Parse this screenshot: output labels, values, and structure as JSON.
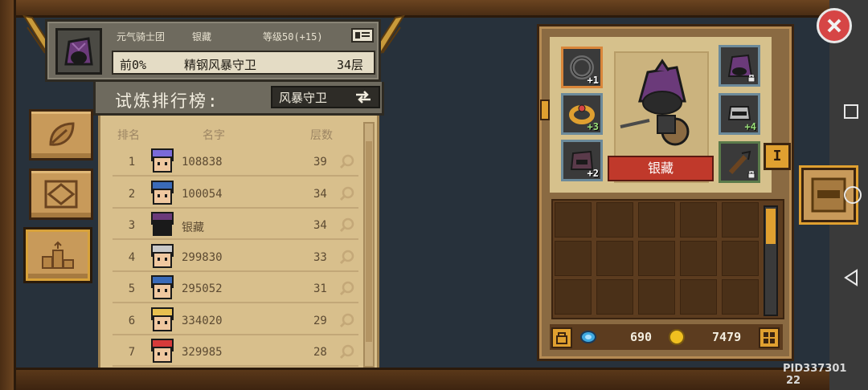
{
  "profile": {
    "guild": "元气骑士团",
    "player_name": "银藏",
    "level": "等级50(+15)",
    "rank_percent": "前0%",
    "boss_title": "精钢风暴守卫",
    "floor": "34层"
  },
  "leaderboard": {
    "title": "试炼排行榜:",
    "boss_select": "风暴守卫",
    "headers": {
      "rank": "排名",
      "name": "名字",
      "floor": "层数"
    },
    "rows": [
      {
        "rank": "1",
        "name": "108838",
        "floor": "39",
        "avatar": "purple-hair"
      },
      {
        "rank": "2",
        "name": "100054",
        "floor": "34",
        "avatar": "cap-knight"
      },
      {
        "rank": "3",
        "name": "银藏",
        "floor": "34",
        "avatar": "purple-hood"
      },
      {
        "rank": "4",
        "name": "299830",
        "floor": "33",
        "avatar": "silver-helm"
      },
      {
        "rank": "5",
        "name": "295052",
        "floor": "31",
        "avatar": "cap-knight"
      },
      {
        "rank": "6",
        "name": "334020",
        "floor": "29",
        "avatar": "blonde-hat"
      },
      {
        "rank": "7",
        "name": "329985",
        "floor": "28",
        "avatar": "red-hair"
      }
    ]
  },
  "equipment": {
    "character_name": "银藏",
    "tier": "I",
    "slots_left": [
      {
        "icon": "ring-dark-icon",
        "plus": "+1"
      },
      {
        "icon": "ring-gold-icon",
        "plus": "+3"
      },
      {
        "icon": "helmet-purple-icon",
        "plus": "+2"
      }
    ],
    "slots_right": [
      {
        "icon": "hood-purple-icon",
        "locked": true
      },
      {
        "icon": "helmet-silver-icon",
        "plus": "+4"
      },
      {
        "icon": "weapon-staff-icon",
        "locked": true
      }
    ]
  },
  "currency": {
    "gems": "690",
    "coins": "7479"
  },
  "footer": {
    "pid": "PID337301",
    "page": "22"
  },
  "colors": {
    "accent": "#e0a030",
    "ribbon": "#c0392b",
    "panel": "#d8bf8c",
    "close": "#d64545"
  }
}
